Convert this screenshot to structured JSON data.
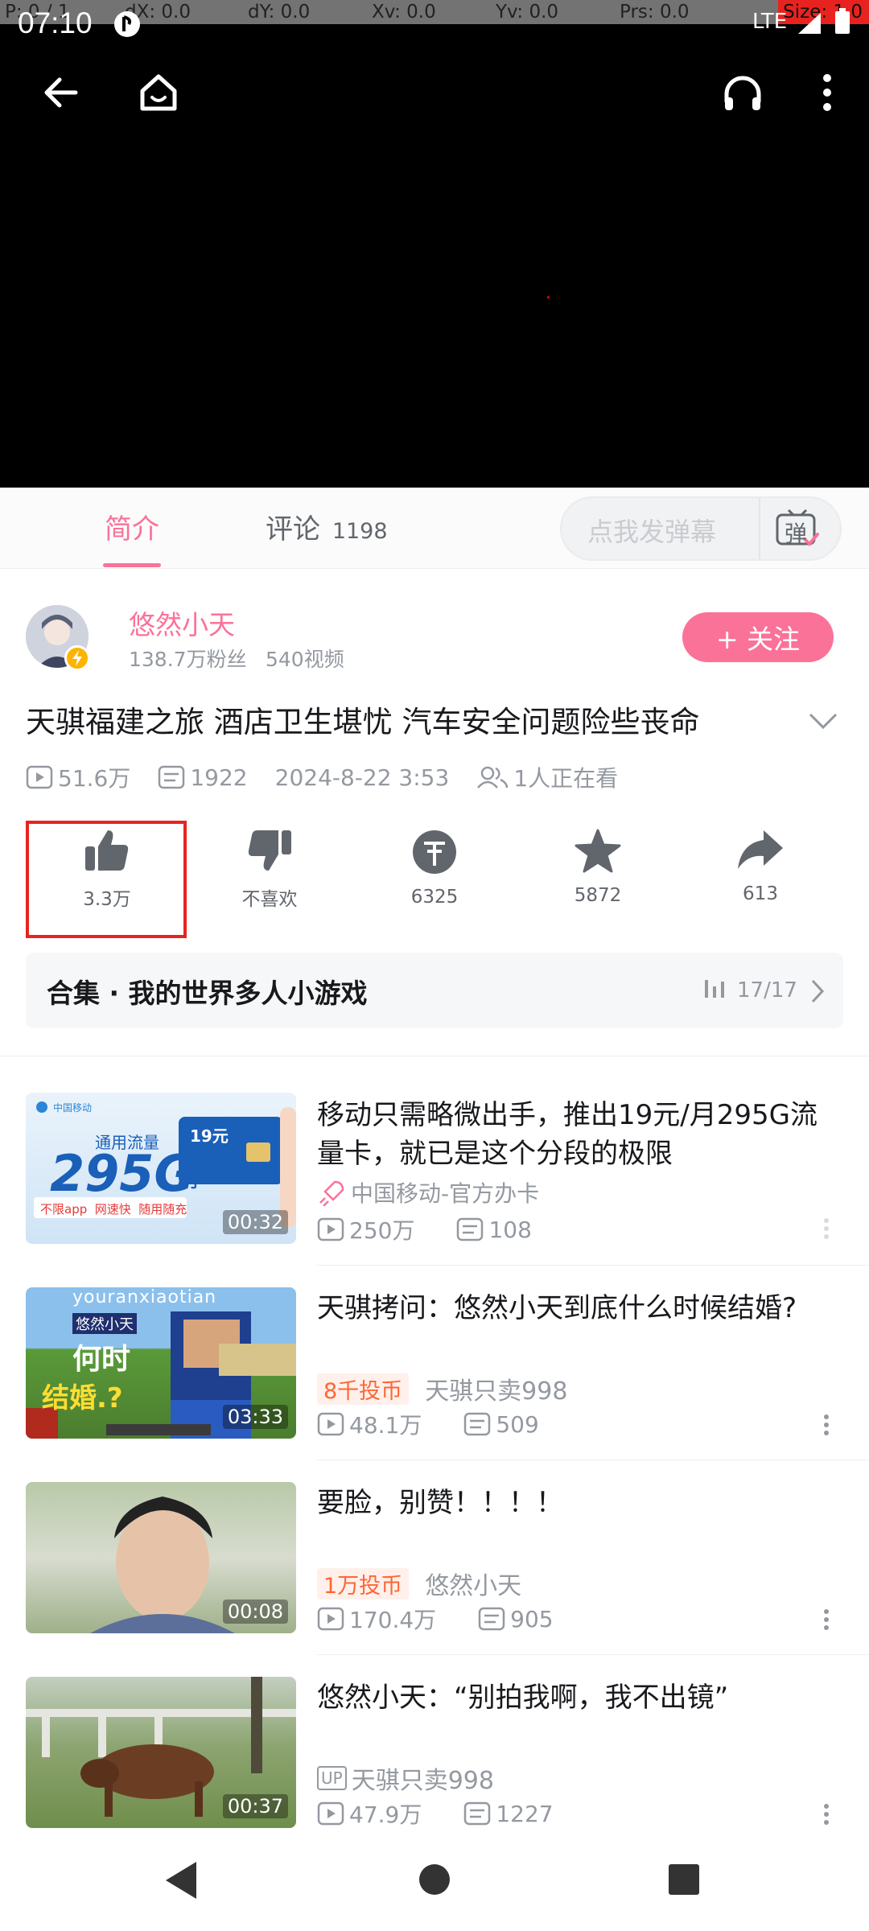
{
  "debug": {
    "p": "P: 0 / 1",
    "dx": "dX: 0.0",
    "dy": "dY: 0.0",
    "xv": "Xv: 0.0",
    "yv": "Yv: 0.0",
    "prs": "Prs: 0.0",
    "size": "Size: 1.0"
  },
  "status": {
    "time": "07:10",
    "network": "LTE"
  },
  "tabs": {
    "intro": "简介",
    "comments": "评论",
    "comments_count": "1198"
  },
  "danmaku": {
    "placeholder": "点我发弹幕",
    "icon_text": "弹"
  },
  "author": {
    "name": "悠然小天",
    "fans": "138.7万粉丝",
    "videos": "540视频",
    "follow_label": "+ 关注"
  },
  "video": {
    "title": "天骐福建之旅 酒店卫生堪忧 汽车安全问题险些丧命",
    "views": "51.6万",
    "danmaku_count": "1922",
    "date": "2024-8-22 3:53",
    "watching": "1人正在看"
  },
  "actions": {
    "like": "3.3万",
    "dislike": "不喜欢",
    "coin": "6325",
    "favorite": "5872",
    "share": "613"
  },
  "collection": {
    "title": "合集 · 我的世界多人小游戏",
    "progress": "17/17"
  },
  "related": [
    {
      "title": "移动只需略微出手，推出19元/月295G流量卡，就已是这个分段的极限",
      "badge": "",
      "up_tag": "",
      "author": "中国移动-官方办卡",
      "views": "250万",
      "comments": "108",
      "duration": "00:32",
      "thumb_text": {
        "brand": "中国移动",
        "label": "通用流量",
        "price": "19元",
        "big": "295G",
        "unit": "/月",
        "tags": "不限app  网速快  随用随充"
      }
    },
    {
      "title": "天骐拷问：悠然小天到底什么时候结婚?",
      "badge": "8千投币",
      "up_tag": "",
      "author": "天骐只卖998",
      "views": "48.1万",
      "comments": "509",
      "duration": "03:33",
      "thumb_text": {
        "top": "youranxiaotian",
        "name": "悠然小天",
        "q1": "何时",
        "q2": "结婚.?"
      }
    },
    {
      "title": "要脸，别赞！！！！",
      "badge": "1万投币",
      "up_tag": "",
      "author": "悠然小天",
      "views": "170.4万",
      "comments": "905",
      "duration": "00:08"
    },
    {
      "title": "悠然小天：“别拍我啊，我不出镜”",
      "badge": "",
      "up_tag": "UP",
      "author": "天骐只卖998",
      "views": "47.9万",
      "comments": "1227",
      "duration": "00:37"
    }
  ],
  "colors": {
    "accent": "#fb7299",
    "text": "#18191c",
    "muted": "#9499a0",
    "highlight_box": "#e8231f"
  }
}
